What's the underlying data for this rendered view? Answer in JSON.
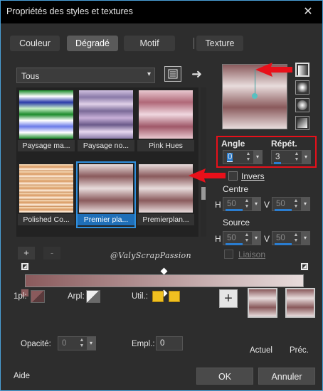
{
  "window": {
    "title": "Propriétés des styles et textures",
    "close_glyph": "✕"
  },
  "tabs": [
    {
      "label": "Couleur",
      "active": false
    },
    {
      "label": "Dégradé",
      "active": true
    },
    {
      "label": "Motif",
      "active": false
    },
    {
      "label": "Texture",
      "active": false
    }
  ],
  "gallery": {
    "category": "Tous",
    "items": [
      {
        "label": "Paysage ma...",
        "selected": false
      },
      {
        "label": "Paysage no...",
        "selected": false
      },
      {
        "label": "Pink Hues",
        "selected": false
      },
      {
        "label": "Polished Co...",
        "selected": false
      },
      {
        "label": "Premier pla...",
        "selected": true
      },
      {
        "label": "Premierplan...",
        "selected": false
      }
    ],
    "add_label": "+",
    "remove_label": "-"
  },
  "watermark": "@ValyScrapPassion",
  "colors": {
    "accent": "#2f8fdd",
    "highlight_red": "#e8101a",
    "gradient_light": "#e8dcdc",
    "gradient_dark": "#8a5a5c",
    "util_gold": "#f0c020"
  },
  "params": {
    "angle_label": "Angle",
    "angle_value": "0",
    "repeat_label": "Répét.",
    "repeat_value": "3",
    "invert_label": "Invers",
    "invert_checked": false,
    "center_label": "Centre",
    "center_h": "50",
    "center_v": "50",
    "source_label": "Source",
    "source_h": "50",
    "source_v": "50",
    "h_label": "H",
    "v_label": "V",
    "link_label": "Liaison"
  },
  "style_buttons": [
    "linear-gradient-icon",
    "rectangular-gradient-icon",
    "radial-gradient-icon",
    "corner-gradient-icon"
  ],
  "lower": {
    "opl_label": "1pl:",
    "arpl_label": "Arpl:",
    "util_label": "Util.:",
    "opacity_label": "Opacité:",
    "opacity_value": "0",
    "empl_label": "Empl.:",
    "empl_value": "0",
    "current_label": "Actuel",
    "previous_label": "Préc.",
    "plus_label": "+"
  },
  "footer": {
    "help": "Aide",
    "ok": "OK",
    "cancel": "Annuler"
  }
}
